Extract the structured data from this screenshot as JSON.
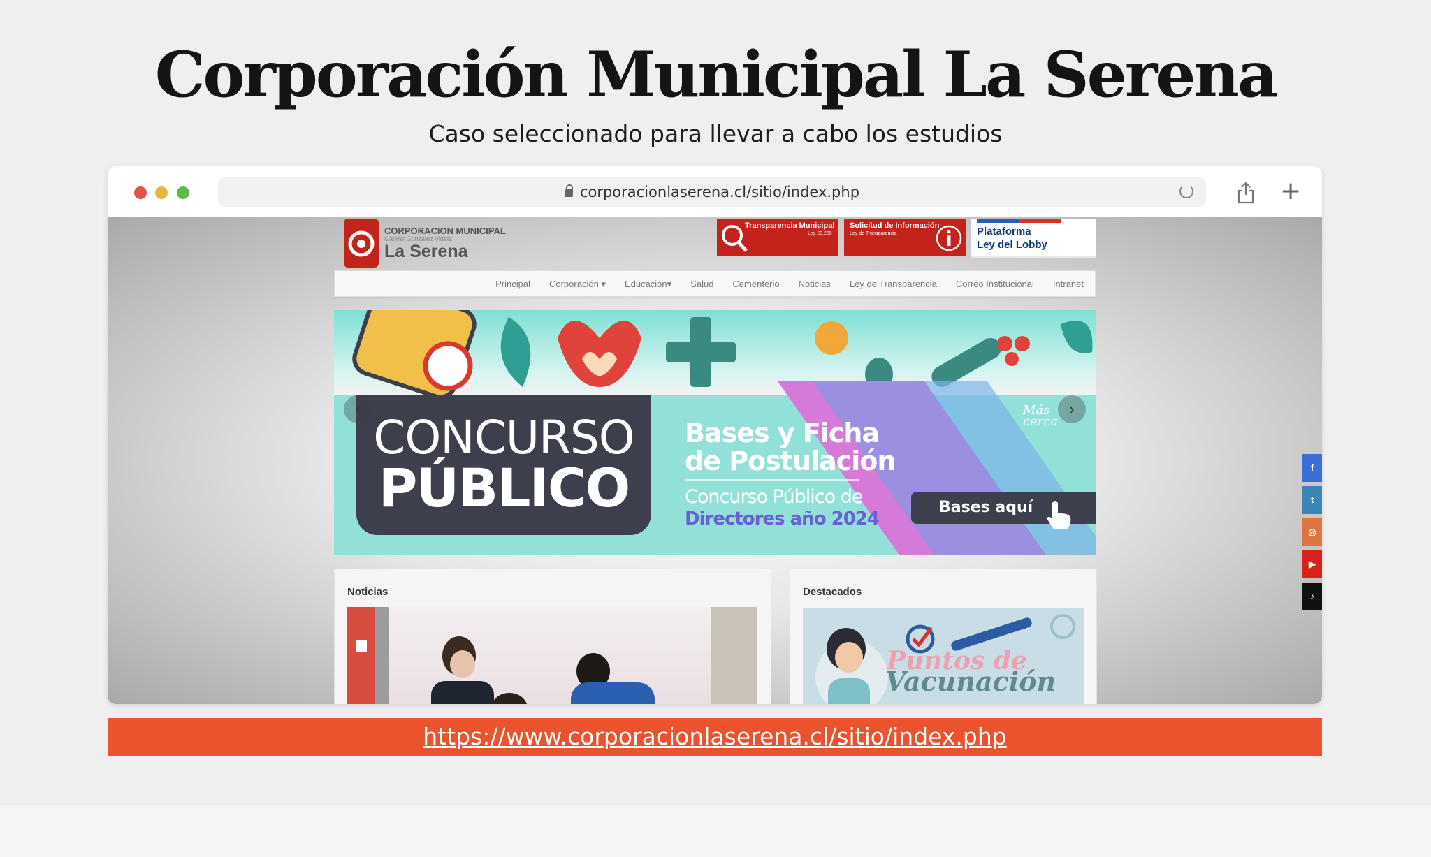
{
  "slide": {
    "title": "Corporación Municipal La Serena",
    "subtitle": "Caso seleccionado para llevar a cabo los estudios",
    "link": "https://www.corporacionlaserena.cl/sitio/index.php"
  },
  "browser": {
    "url": "corporacionlaserena.cl/sitio/index.php",
    "traffic_colors": [
      "#e0524a",
      "#e9b740",
      "#5dbb4c"
    ]
  },
  "site": {
    "logo": {
      "line1": "CORPORACION MUNICIPAL",
      "line2": "Gabriel González Videla",
      "line3": "La Serena"
    },
    "header_buttons": [
      {
        "title": "Transparencia Municipal",
        "subtitle": "Ley 20.285"
      },
      {
        "title": "Solicitud de Información",
        "subtitle": "Ley de Transparencia"
      },
      {
        "title": "Plataforma",
        "subtitle": "Ley del Lobby"
      }
    ],
    "nav": [
      "Principal",
      "Corporación ▾",
      "Educación▾",
      "Salud",
      "Cementerio",
      "Noticias",
      "Ley de Transparencia",
      "Correo Institucional",
      "Intranet"
    ],
    "banner": {
      "concurso_l1": "CONCURSO",
      "concurso_l2": "PÚBLICO",
      "bases_l1": "Bases y Ficha",
      "bases_l2": "de Postulación",
      "bases_l3": "Concurso Público de",
      "bases_l4": "Directores año 2024",
      "button": "Bases aquí",
      "brand_l1": "Más",
      "brand_l2": "cerca",
      "prev": "‹",
      "next": "›"
    },
    "news_title": "Noticias",
    "featured_title": "Destacados",
    "featured_l1": "Puntos de",
    "featured_l2": "Vacunación",
    "social": [
      {
        "icon": "facebook-icon",
        "glyph": "f",
        "color": "#3b6fd8"
      },
      {
        "icon": "twitter-icon",
        "glyph": "t",
        "color": "#3a86b7"
      },
      {
        "icon": "instagram-icon",
        "glyph": "◎",
        "color": "#e0743f"
      },
      {
        "icon": "youtube-icon",
        "glyph": "▶",
        "color": "#d8231d"
      },
      {
        "icon": "tiktok-icon",
        "glyph": "♪",
        "color": "#111111"
      }
    ]
  }
}
